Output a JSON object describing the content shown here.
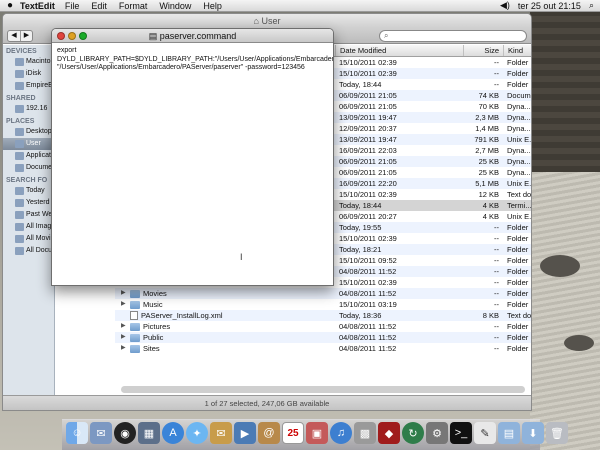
{
  "menubar": {
    "app_name": "TextEdit",
    "menus": [
      "File",
      "Edit",
      "Format",
      "Window",
      "Help"
    ],
    "clock": "ter 25 out  21:15"
  },
  "finder": {
    "title": "User",
    "sidebar": [
      {
        "type": "head",
        "label": "DEVICES"
      },
      {
        "type": "item",
        "label": "Macinto"
      },
      {
        "type": "item",
        "label": "iDisk"
      },
      {
        "type": "item",
        "label": "EmpireE"
      },
      {
        "type": "head",
        "label": "SHARED"
      },
      {
        "type": "item",
        "label": "192.16"
      },
      {
        "type": "head",
        "label": "PLACES"
      },
      {
        "type": "item",
        "label": "Desktop"
      },
      {
        "type": "item",
        "label": "User",
        "selected": true
      },
      {
        "type": "item",
        "label": "Applicat"
      },
      {
        "type": "item",
        "label": "Docume"
      },
      {
        "type": "head",
        "label": "SEARCH FO"
      },
      {
        "type": "item",
        "label": "Today"
      },
      {
        "type": "item",
        "label": "Yesterd"
      },
      {
        "type": "item",
        "label": "Past We"
      },
      {
        "type": "item",
        "label": "All Imag"
      },
      {
        "type": "item",
        "label": "All Movi"
      },
      {
        "type": "item",
        "label": "All Docu"
      }
    ],
    "columns": {
      "date": "Date Modified",
      "size": "Size",
      "kind": "Kind"
    },
    "rows": [
      {
        "name": "",
        "date": "15/10/2011 02:39",
        "size": "--",
        "kind": "Folder"
      },
      {
        "name": "",
        "date": "15/10/2011 02:39",
        "size": "--",
        "kind": "Folder"
      },
      {
        "name": "",
        "date": "Today, 18:44",
        "size": "--",
        "kind": "Folder"
      },
      {
        "name": "",
        "date": "06/09/2011 21:05",
        "size": "74 KB",
        "kind": "Documen"
      },
      {
        "name": "",
        "date": "06/09/2011 21:05",
        "size": "70 KB",
        "kind": "Dyna..."
      },
      {
        "name": "",
        "date": "13/09/2011 19:47",
        "size": "2,3 MB",
        "kind": "Dyna..."
      },
      {
        "name": "",
        "date": "12/09/2011 20:37",
        "size": "1,4 MB",
        "kind": "Dyna..."
      },
      {
        "name": "",
        "date": "13/09/2011 19:47",
        "size": "791 KB",
        "kind": "Unix E..."
      },
      {
        "name": "",
        "date": "16/09/2011 22:03",
        "size": "2,7 MB",
        "kind": "Dyna..."
      },
      {
        "name": "",
        "date": "06/09/2011 21:05",
        "size": "25 KB",
        "kind": "Dyna..."
      },
      {
        "name": "",
        "date": "06/09/2011 21:05",
        "size": "25 KB",
        "kind": "Dyna..."
      },
      {
        "name": "",
        "date": "16/09/2011 22:20",
        "size": "5,1 MB",
        "kind": "Unix E..."
      },
      {
        "name": "",
        "date": "15/10/2011 02:39",
        "size": "12 KB",
        "kind": "Text doc"
      },
      {
        "name": "",
        "date": "Today, 18:44",
        "size": "4 KB",
        "kind": "Termi...",
        "selected": true
      },
      {
        "name": "",
        "date": "06/09/2011 20:27",
        "size": "4 KB",
        "kind": "Unix E..."
      },
      {
        "name": "",
        "date": "Today, 19:55",
        "size": "--",
        "kind": "Folder"
      },
      {
        "name": "",
        "date": "15/10/2011 02:39",
        "size": "--",
        "kind": "Folder"
      },
      {
        "name": "",
        "date": "Today, 18:21",
        "size": "--",
        "kind": "Folder"
      },
      {
        "name": "",
        "date": "15/10/2011 09:52",
        "size": "--",
        "kind": "Folder"
      },
      {
        "name": "",
        "date": "04/08/2011 11:52",
        "size": "--",
        "kind": "Folder"
      },
      {
        "name": "",
        "date": "15/10/2011 02:39",
        "size": "--",
        "kind": "Folder"
      },
      {
        "name": "Movies",
        "date": "04/08/2011 11:52",
        "size": "--",
        "kind": "Folder",
        "icon": "folder"
      },
      {
        "name": "Music",
        "date": "15/10/2011 03:19",
        "size": "--",
        "kind": "Folder",
        "icon": "folder"
      },
      {
        "name": "PAServer_InstallLog.xml",
        "date": "Today, 18:36",
        "size": "8 KB",
        "kind": "Text doc",
        "icon": "doc"
      },
      {
        "name": "Pictures",
        "date": "04/08/2011 11:52",
        "size": "--",
        "kind": "Folder",
        "icon": "folder"
      },
      {
        "name": "Public",
        "date": "04/08/2011 11:52",
        "size": "--",
        "kind": "Folder",
        "icon": "folder"
      },
      {
        "name": "Sites",
        "date": "04/08/2011 11:52",
        "size": "--",
        "kind": "Folder",
        "icon": "folder"
      }
    ],
    "status": "1 of 27 selected, 247,06 GB available"
  },
  "textedit": {
    "title": "paserver.command",
    "body": "export DYLD_LIBRARY_PATH=$DYLD_LIBRARY_PATH:\"/Users/User/Applications/Embarcadero/PAServer\"\n\"/Users/User/Applications/Embarcadero/PAServer/paserver\" -password=123456"
  },
  "dock": {
    "calendar_day": "25"
  },
  "colors": {
    "close": "#e0443e",
    "minimize": "#dea123",
    "zoom": "#1aab29",
    "selection": "#d4d4d4"
  }
}
